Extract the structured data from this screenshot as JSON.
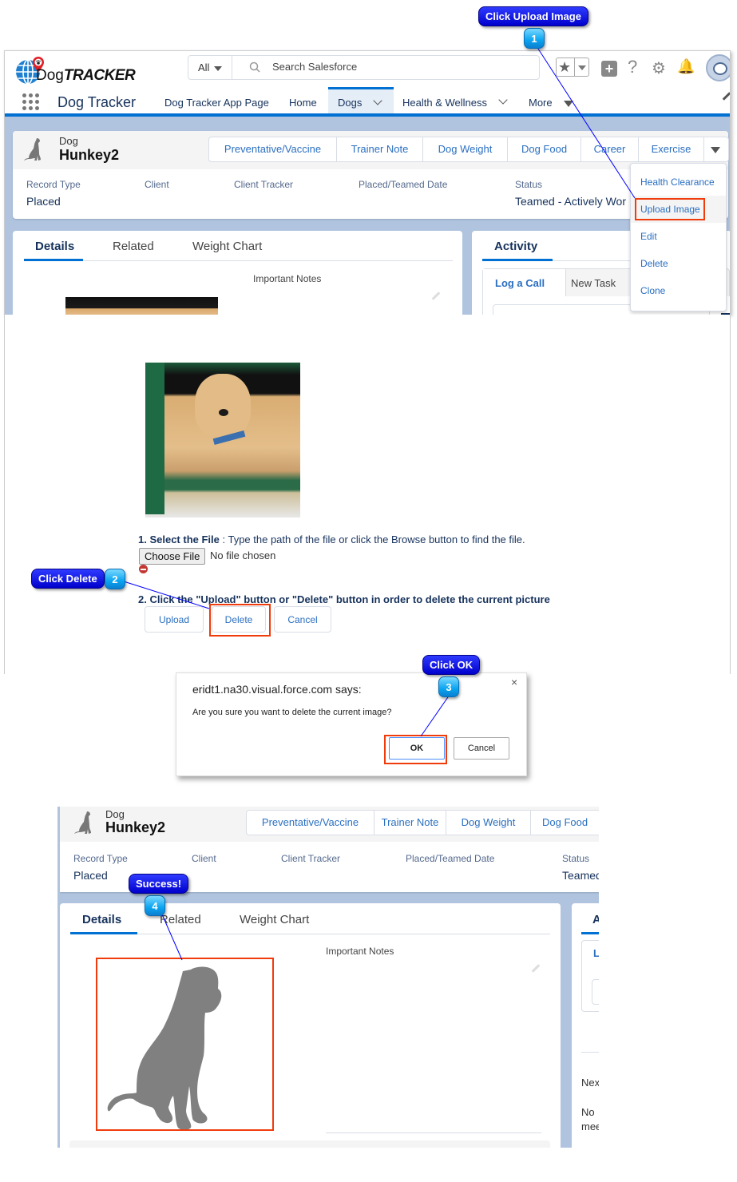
{
  "callouts": [
    {
      "step": "1",
      "label": "Click Upload Image"
    },
    {
      "step": "2",
      "label": "Click Delete"
    },
    {
      "step": "3",
      "label": "Click OK"
    },
    {
      "step": "4",
      "label": "Success!"
    }
  ],
  "header": {
    "logo_prefix": "Dog",
    "logo_suffix": "TRACKER",
    "search_scope": "All",
    "search_placeholder": "Search Salesforce",
    "icons": [
      "star-icon",
      "plus-icon",
      "help-icon",
      "gear-icon",
      "bell-icon",
      "avatar"
    ]
  },
  "nav": {
    "app_name": "Dog Tracker",
    "items": [
      {
        "label": "Dog Tracker App Page"
      },
      {
        "label": "Home"
      },
      {
        "label": "Dogs",
        "active": true
      },
      {
        "label": "Health & Wellness"
      },
      {
        "label": "More"
      }
    ]
  },
  "record": {
    "object_label": "Dog",
    "name": "Hunkey2",
    "actions": [
      "Preventative/Vaccine",
      "Trainer Note",
      "Dog Weight",
      "Dog Food",
      "Career",
      "Exercise"
    ],
    "fields": [
      {
        "label": "Record Type",
        "value": "Placed"
      },
      {
        "label": "Client",
        "value": ""
      },
      {
        "label": "Client Tracker",
        "value": ""
      },
      {
        "label": "Placed/Teamed Date",
        "value": ""
      },
      {
        "label": "Status",
        "value": "Teamed - Actively Wor"
      }
    ],
    "status_truncated_panel4": "Teamed"
  },
  "overflow_menu": {
    "items": [
      "Health Clearance",
      "Upload Image",
      "Edit",
      "Delete",
      "Clone"
    ],
    "highlighted": "Upload Image"
  },
  "detail_tabs": [
    "Details",
    "Related",
    "Weight Chart"
  ],
  "active_detail_tab": "Details",
  "important_notes_label": "Important Notes",
  "activity": {
    "title": "Activity",
    "tabs": [
      "Log a Call",
      "New Task"
    ],
    "next_steps_partial": "Nex",
    "no_activities_partial_1": "No",
    "no_activities_partial_2": "mee"
  },
  "upload_page": {
    "step1_bold": "1. Select the File",
    "step1_text": " : Type the path of the file or click the Browse button to find the file.",
    "choose_file_label": "Choose File",
    "no_file_text": "No file chosen",
    "step2_text": "2. Click the \"Upload\" button or \"Delete\" button in order to delete the current picture",
    "buttons": [
      "Upload",
      "Delete",
      "Cancel"
    ]
  },
  "dialog": {
    "title": "eridt1.na30.visual.force.com says:",
    "message": "Are you sure you want to delete the current image?",
    "ok_label": "OK",
    "cancel_label": "Cancel",
    "close_glyph": "×"
  },
  "colors": {
    "callout_blue": "#0000cc",
    "badge_cyan": "#0aa4f0",
    "highlight_red": "#f03c0c",
    "brand_blue": "#0070d2",
    "link_blue": "#2a6fc1"
  }
}
